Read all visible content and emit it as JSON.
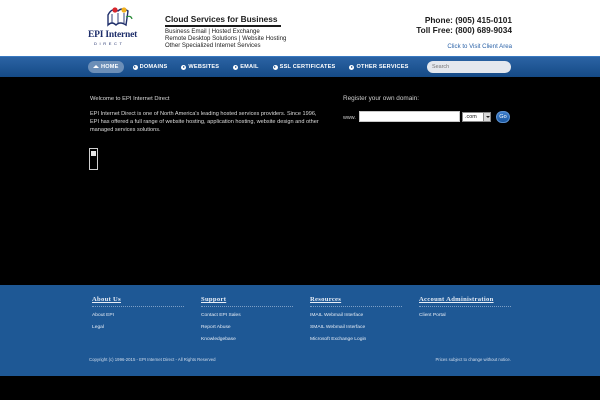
{
  "header": {
    "logo_text": "EPI Internet",
    "logo_sub": "DIRECT",
    "tagline_title": "Cloud Services for Business",
    "tagline_lines": [
      "Business Email | Hosted Exchange",
      "Remote Desktop Solutions | Website Hosting",
      "Other Specialized Internet Services"
    ],
    "phone": "Phone: (905) 415-0101",
    "toll_free": "Toll Free: (800) 689-9034",
    "client_link": "Click to Visit Client Area"
  },
  "nav": {
    "items": [
      {
        "label": "HOME",
        "active": true
      },
      {
        "label": "DOMAINS",
        "active": false
      },
      {
        "label": "WEBSITES",
        "active": false
      },
      {
        "label": "EMAIL",
        "active": false
      },
      {
        "label": "SSL CERTIFICATES",
        "active": false
      },
      {
        "label": "OTHER SERVICES",
        "active": false
      }
    ],
    "search_placeholder": "Search"
  },
  "main": {
    "welcome_title": "Welcome to EPI Internet Direct",
    "welcome_text": "EPI Internet Direct is one of North America's leading hosted services providers. Since 1996, EPI has offered a full range of website hosting, application hosting, website design and other managed services solutions.",
    "register_title": "Register your own domain:",
    "domain_label": "www.",
    "domain_value": "",
    "tld_selected": ".com",
    "go_label": "Go"
  },
  "footer": {
    "columns": [
      {
        "heading": "About Us",
        "links": [
          "About EPI",
          "Legal"
        ]
      },
      {
        "heading": "Support",
        "links": [
          "Contact EPI Sales",
          "Report Abuse",
          "Knowledgebase"
        ]
      },
      {
        "heading": "Resources",
        "links": [
          "IMAIL Webmail Interface",
          "SMAIL Webmail Interface",
          "Microsoft Exchange Login"
        ]
      },
      {
        "heading": "Account Administration",
        "links": [
          "Client Portal"
        ]
      }
    ],
    "copyright": "Copyright (c) 1996-2015 - EPI Internet Direct - All Rights Reserved",
    "notice": "Prices subject to change without notice."
  },
  "colors": {
    "nav_blue": "#1f5894",
    "footer_blue": "#1e5895",
    "logo_navy": "#1f2f6b",
    "link_blue": "#2c63a8"
  }
}
